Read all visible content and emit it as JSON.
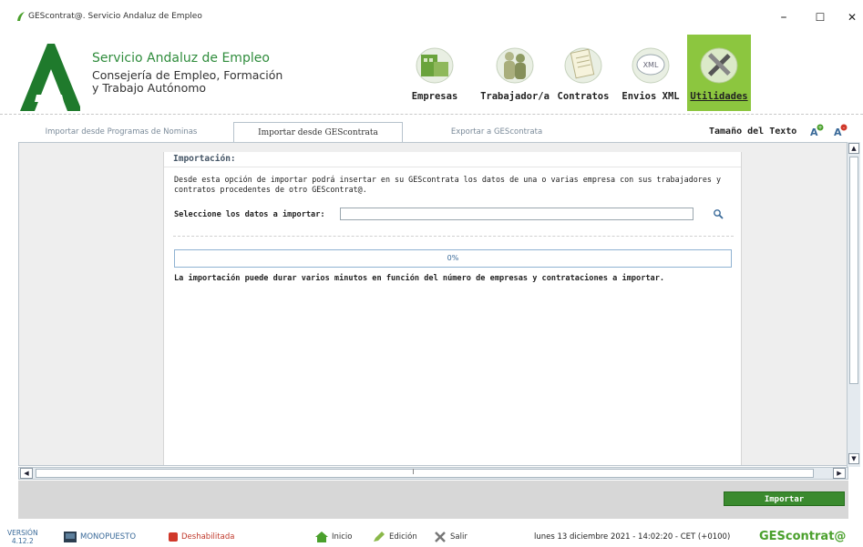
{
  "window": {
    "title": "GEScontrat@. Servicio Andaluz de Empleo",
    "minimize": "–",
    "maximize": "☐",
    "close": "✕"
  },
  "header": {
    "org_title": "Servicio Andaluz de Empleo",
    "org_sub_1": "Consejería de Empleo, Formación",
    "org_sub_2": "y Trabajo Autónomo",
    "nav": [
      {
        "label": "Empresas",
        "icon": "companies-icon"
      },
      {
        "label": "Trabajador/a",
        "icon": "workers-icon"
      },
      {
        "label": "Contratos",
        "icon": "contracts-icon"
      },
      {
        "label": "Envios XML",
        "icon": "xml-icon"
      },
      {
        "label": "Utilidades",
        "icon": "tools-icon",
        "active": true
      }
    ]
  },
  "tabs": [
    {
      "label": "Importar desde Programas de Nominas"
    },
    {
      "label": "Importar desde GEScontrata",
      "active": true
    },
    {
      "label": "Exportar a GEScontrata"
    }
  ],
  "text_size": {
    "label": "Tamaño del Texto"
  },
  "import_panel": {
    "title": "Importación:",
    "description": "Desde esta opción de importar podrá insertar en su GEScontrata los datos de una o varias empresa con sus trabajadores y contratos procedentes de otro GEScontrat@.",
    "select_label": "Seleccione los datos a importar:",
    "file_value": "",
    "progress_text": "0%",
    "progress_fraction": 0,
    "note": "La importación puede durar varios minutos en función del número de empresas y contrataciones a importar."
  },
  "actions": {
    "import_label": "Importar"
  },
  "status": {
    "version_label": "VERSIÓN",
    "version_number": "4.12.2",
    "workstation": "MONOPUESTO",
    "disabled": "Deshabilitada",
    "home": "Inicio",
    "edit": "Edición",
    "exit": "Salir",
    "datetime": "lunes 13 diciembre 2021 - 14:02:20 - CET (+0100)",
    "brand": "GEScontrat@"
  },
  "colors": {
    "accent_green": "#8cc63f",
    "button_green": "#3a8a2e",
    "brand_green": "#4aa02c"
  }
}
